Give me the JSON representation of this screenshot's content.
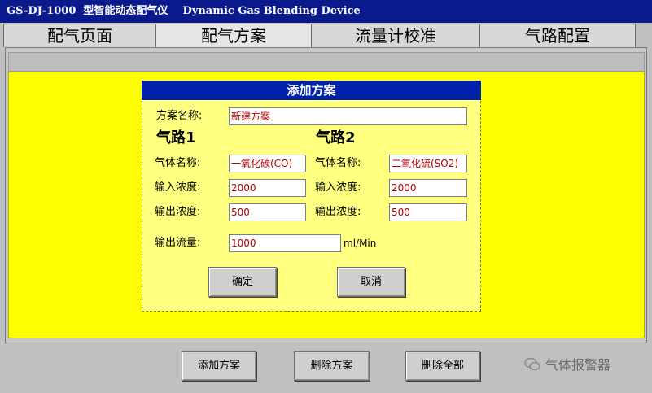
{
  "window": {
    "title": "GS-DJ-1000  型智能动态配气仪    Dynamic Gas Blending Device"
  },
  "tabs": [
    {
      "label": "配气页面"
    },
    {
      "label": "配气方案"
    },
    {
      "label": "流量计校准"
    },
    {
      "label": "气路配置"
    }
  ],
  "dialog": {
    "title": "添加方案",
    "scheme_label": "方案名称:",
    "scheme_value": "新建方案",
    "path1": {
      "heading": "气路1",
      "gas_label": "气体名称:",
      "gas_value": "一氧化碳(CO)",
      "input_label": "输入浓度:",
      "input_value": "2000",
      "output_label": "输出浓度:",
      "output_value": "500"
    },
    "path2": {
      "heading": "气路2",
      "gas_label": "气体名称:",
      "gas_value": "二氧化硫(SO2)",
      "input_label": "输入浓度:",
      "input_value": "2000",
      "output_label": "输出浓度:",
      "output_value": "500"
    },
    "flow_label": "输出流量:",
    "flow_value": "1000",
    "flow_unit": "ml/Min",
    "ok_label": "确定",
    "cancel_label": "取消"
  },
  "bottom": {
    "add_label": "添加方案",
    "delete_label": "删除方案",
    "delete_all_label": "删除全部"
  },
  "watermark": {
    "text": "气体报警器"
  },
  "colors": {
    "title_bar": "#0a1a8c",
    "panel": "#ffff00",
    "dialog": "#ffff80",
    "dialog_title": "#0022aa",
    "value_text": "#b00000"
  }
}
